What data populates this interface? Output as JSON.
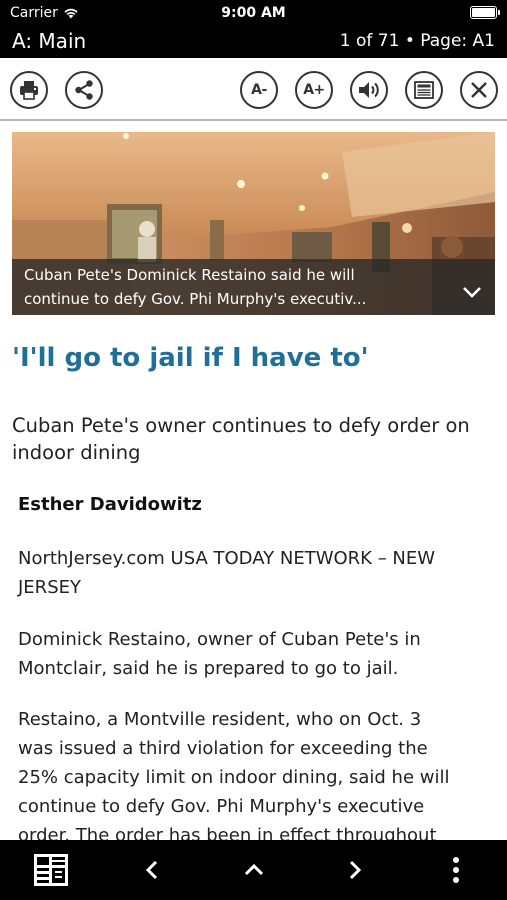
{
  "status_bar": {
    "carrier": "Carrier",
    "time": "9:00 AM"
  },
  "header": {
    "section_title": "A: Main",
    "page_info": "1 of 71 • Page: A1"
  },
  "toolbar": {
    "font_decrease_label": "A-",
    "font_increase_label": "A+",
    "icons": [
      "printer-icon",
      "share-icon",
      "speaker-icon",
      "newspaper-icon",
      "close-icon"
    ]
  },
  "hero": {
    "caption_line1": "Cuban Pete's Dominick Restaino said he will",
    "caption_line2": "continue to defy Gov. Phi Murphy's executiv..."
  },
  "article": {
    "headline": "'I'll go to jail if I have to'",
    "subhead": "Cuban Pete's owner continues to defy order on indoor dining",
    "byline": "Esther Davidowitz",
    "source": "NorthJersey.com USA TODAY NETWORK – NEW JERSEY",
    "paragraph1": "Dominick Restaino, owner of Cuban Pete's in Montclair, said he is prepared to go to jail.",
    "paragraph2_lines": [
      "Restaino, a Montville resident, who on Oct. 3",
      "was issued a third violation for exceeding the",
      "25% capacity limit on indoor dining, said he will",
      "continue to defy Gov. Phi Murphy's executive",
      "order. The order has been in effect throughout"
    ]
  },
  "colors": {
    "headline": "#1f6f98",
    "bars": "#000000"
  },
  "bottom_bar": {
    "icons": [
      "page-thumbnails-icon",
      "chevron-left-icon",
      "chevron-up-icon",
      "chevron-right-icon",
      "more-vertical-icon"
    ]
  }
}
